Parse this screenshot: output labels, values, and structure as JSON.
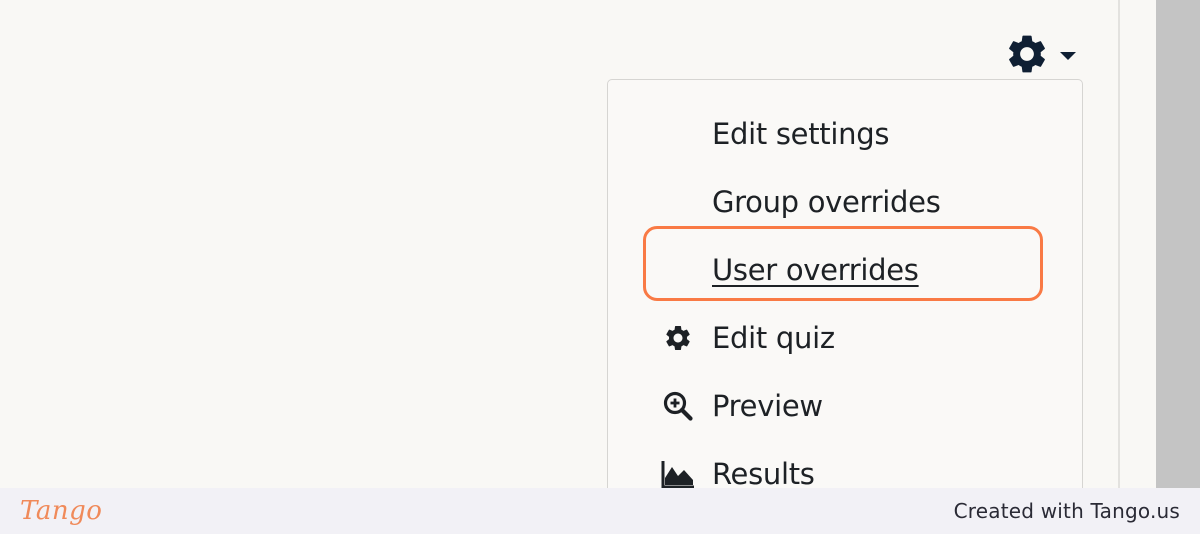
{
  "toolbar": {
    "settings_icon": "gear-icon",
    "caret_icon": "caret-down-icon"
  },
  "menu": {
    "items": [
      {
        "label": "Edit settings",
        "icon": null
      },
      {
        "label": "Group overrides",
        "icon": null
      },
      {
        "label": "User overrides",
        "icon": null,
        "highlighted": true
      },
      {
        "label": "Edit quiz",
        "icon": "gear-icon"
      },
      {
        "label": "Preview",
        "icon": "zoom-in-icon"
      },
      {
        "label": "Results",
        "icon": "area-chart-icon"
      }
    ]
  },
  "colors": {
    "highlight": "#f97a45",
    "icon": "#0f1f33",
    "brand": "#f08a5a"
  },
  "footer": {
    "brand": "Tango",
    "credit": "Created with Tango.us"
  }
}
